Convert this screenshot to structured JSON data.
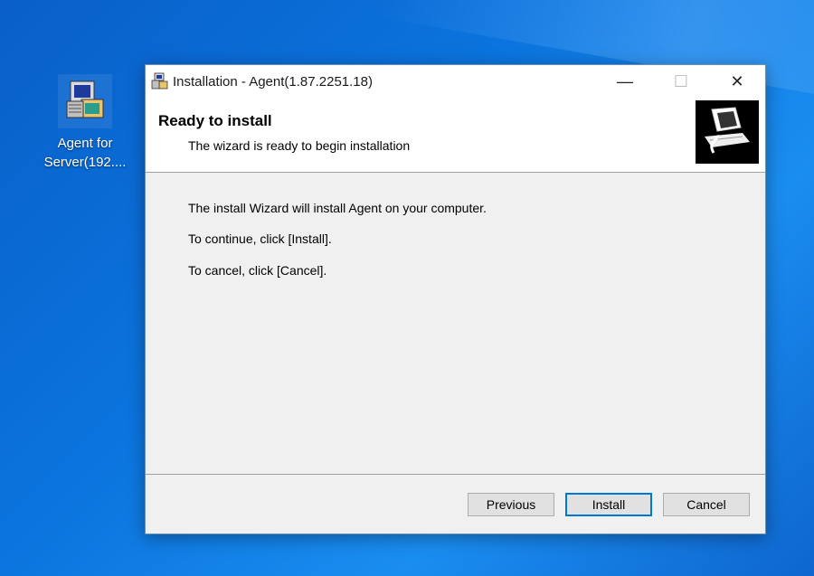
{
  "desktop": {
    "icon_label_line1": "Agent for",
    "icon_label_line2": "Server(192...."
  },
  "window": {
    "title": "Installation - Agent(1.87.2251.18)",
    "controls": {
      "minimize": "—",
      "maximize": "☐",
      "close": "✕"
    }
  },
  "header": {
    "title": "Ready to install",
    "subtitle": "The wizard is ready to begin installation"
  },
  "body": {
    "line1": "The install Wizard will install Agent on your computer.",
    "line2": "To continue, click [Install].",
    "line3": "To cancel, click [Cancel]."
  },
  "buttons": {
    "previous": "Previous",
    "install": "Install",
    "cancel": "Cancel"
  },
  "colors": {
    "desktop_blue": "#0b74de",
    "focus_border": "#0078d7"
  }
}
